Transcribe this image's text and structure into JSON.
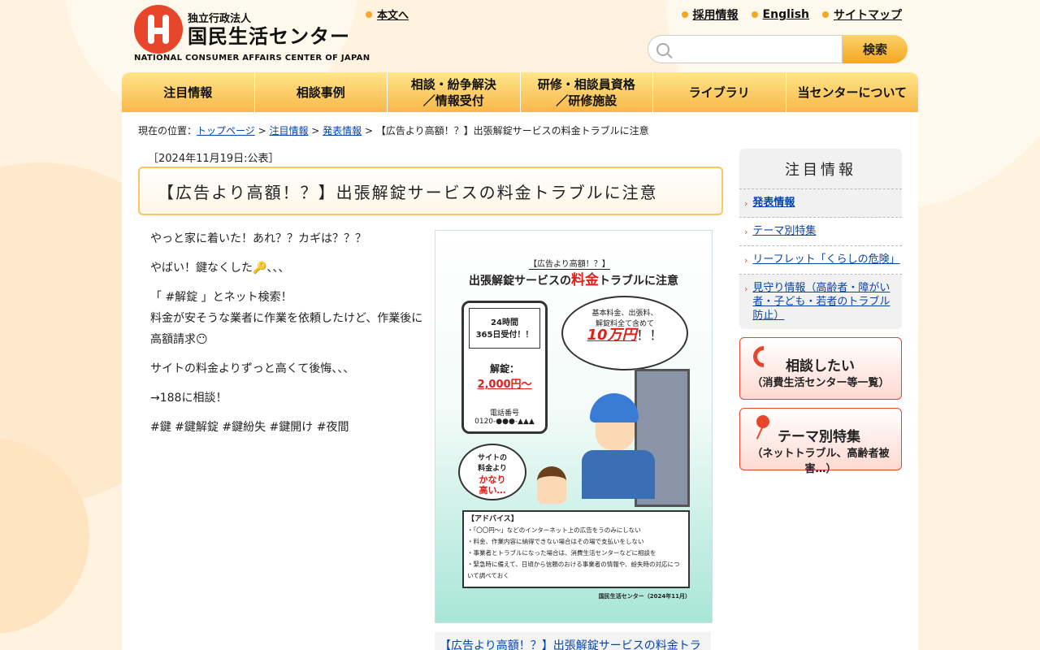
{
  "header": {
    "logo_sub": "独立行政法人",
    "logo_main": "国民生活センター",
    "logo_en": "NATIONAL CONSUMER AFFAIRS CENTER OF JAPAN",
    "skip_link": "本文へ",
    "top_links": [
      "採用情報",
      "English",
      "サイトマップ"
    ],
    "search_placeholder": "",
    "search_button": "検索"
  },
  "nav": {
    "items": [
      "注目情報",
      "相談事例",
      "相談・紛争解決\n／情報受付",
      "研修・相談員資格\n／研修施設",
      "ライブラリ",
      "当センターについて"
    ]
  },
  "breadcrumb": {
    "prefix": "現在の位置：",
    "links": [
      "トップページ",
      "注目情報",
      "発表情報"
    ],
    "current": "【広告より高額！？】出張解錠サービスの料金トラブルに注意"
  },
  "article": {
    "date": "［2024年11月19日:公表］",
    "title": "【広告より高額！？】出張解錠サービスの料金トラブルに注意",
    "paragraphs": [
      "やっと家に着いた！あれ？？カギは？？？",
      "やばい！鍵なくした🔑、、、",
      "「 #解錠 」とネット検索！\n料金が安そうな業者に作業を依頼したけど、作業後に高額請求😶",
      "サイトの料金よりずっと高くて後悔、、、",
      "→188に相談！",
      "#鍵 #鍵解錠 #鍵紛失 #鍵開け #夜間"
    ],
    "poster": {
      "tag": "【広告より高額！？】",
      "head_pre": "出張解錠サービスの",
      "head_red": "料金",
      "head_post": "トラブルに注意",
      "phone_line1": "24時間",
      "phone_line2": "365日受付！！",
      "phone_kai": "解錠：",
      "phone_price": "2,000円〜",
      "phone_tel_label": "電話番号",
      "phone_tel": "0120-●●●-▲▲▲",
      "bubble_line1": "基本料金、出張料、",
      "bubble_line2": "解錠料全て含めて",
      "bubble_big": "10万円",
      "bubble_suffix": "！！",
      "thought_line1": "サイトの",
      "thought_line2": "料金より",
      "thought_red1": "かなり",
      "thought_red2": "高い…",
      "advice_head": "【アドバイス】",
      "advice_items": [
        "・「〇〇円〜」などのインターネット上の広告をうのみにしない",
        "・料金、作業内容に納得できない場合はその場で支払いをしない",
        "・事業者とトラブルになった場合は、消費生活センターなどに相談を",
        "・緊急時に備えて、日頃から信頼のおける事業者の情報や、紛失時の対応について調べておく"
      ],
      "footer": "国民生活センター（2024年11月）"
    },
    "caption_link": "【広告より高額！？】出張解錠サービスの料金トラ"
  },
  "sidebar": {
    "title": "注目情報",
    "items": [
      "発表情報",
      "テーマ別特集",
      "リーフレット「くらしの危険」",
      "見守り情報（高齢者・障がい者・子ども・若者のトラブル防止）"
    ],
    "banner1_title": "相談したい",
    "banner1_sub": "（消費生活センター等一覧）",
    "banner2_title": "テーマ別特集",
    "banner2_sub": "（ネットトラブル、高齢者被害…）"
  },
  "colors": {
    "accent": "#f5a623",
    "brand_red": "#e8462a",
    "link": "#0645ad"
  }
}
